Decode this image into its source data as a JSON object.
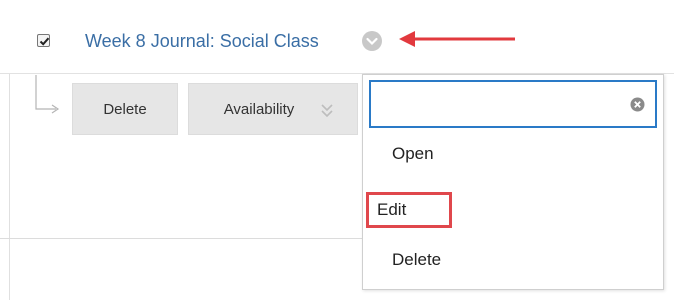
{
  "item": {
    "title": "Week 8 Journal: Social Class",
    "checked": true
  },
  "actions": {
    "delete_label": "Delete",
    "availability_label": "Availability"
  },
  "menu": {
    "search_value": "",
    "items": [
      {
        "label": "Open"
      },
      {
        "label": "Edit",
        "highlighted": true
      },
      {
        "label": "Delete"
      }
    ]
  },
  "colors": {
    "link": "#3a6ea5",
    "highlight": "#e0474c",
    "focus": "#2a7ac7"
  },
  "icons": {
    "checkbox": "checkmark-icon",
    "title_chevron": "chevron-down-circle-icon",
    "annotation": "arrow-left-icon",
    "availability_chevron": "double-chevron-down-icon",
    "clear": "clear-x-circle-icon"
  }
}
